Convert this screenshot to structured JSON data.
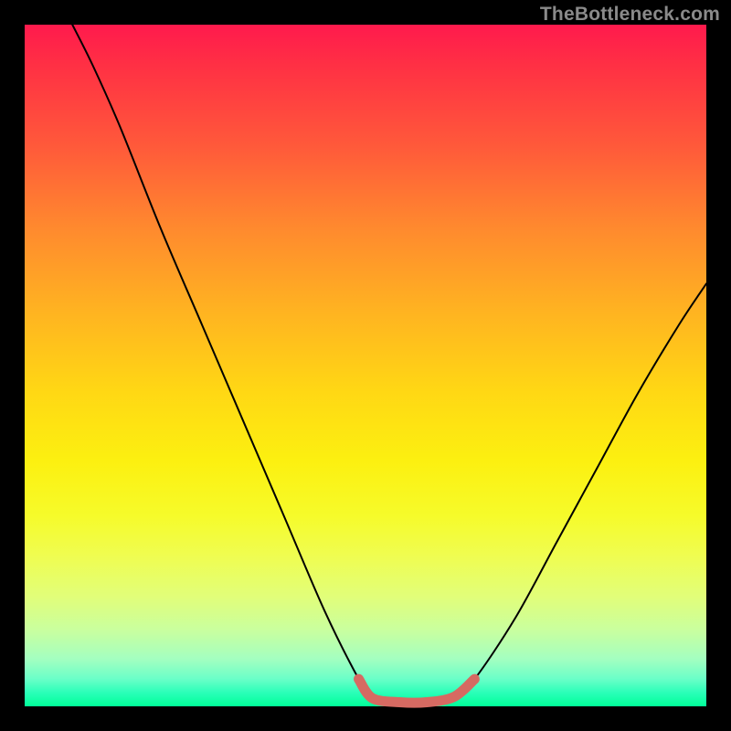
{
  "watermark": "TheBottleneck.com",
  "chart_data": {
    "type": "line",
    "title": "",
    "xlabel": "",
    "ylabel": "",
    "xlim": [
      0,
      100
    ],
    "ylim": [
      0,
      100
    ],
    "grid": false,
    "legend": "none",
    "series": [
      {
        "name": "bottleneck-curve",
        "points": [
          {
            "x": 7,
            "y": 100
          },
          {
            "x": 10,
            "y": 94
          },
          {
            "x": 14,
            "y": 85
          },
          {
            "x": 20,
            "y": 70
          },
          {
            "x": 26,
            "y": 56
          },
          {
            "x": 32,
            "y": 42
          },
          {
            "x": 38,
            "y": 28
          },
          {
            "x": 44,
            "y": 14
          },
          {
            "x": 49,
            "y": 4
          },
          {
            "x": 51,
            "y": 1.2
          },
          {
            "x": 55,
            "y": 0.6
          },
          {
            "x": 59,
            "y": 0.6
          },
          {
            "x": 63,
            "y": 1.4
          },
          {
            "x": 66,
            "y": 4
          },
          {
            "x": 72,
            "y": 13
          },
          {
            "x": 78,
            "y": 24
          },
          {
            "x": 84,
            "y": 35
          },
          {
            "x": 90,
            "y": 46
          },
          {
            "x": 96,
            "y": 56
          },
          {
            "x": 100,
            "y": 62
          }
        ]
      },
      {
        "name": "optimal-range",
        "points": [
          {
            "x": 49,
            "y": 4
          },
          {
            "x": 51,
            "y": 1.2
          },
          {
            "x": 55,
            "y": 0.6
          },
          {
            "x": 59,
            "y": 0.6
          },
          {
            "x": 63,
            "y": 1.4
          },
          {
            "x": 66,
            "y": 4
          }
        ]
      }
    ],
    "colors": {
      "gradient_top": "#ff1a4d",
      "gradient_bottom": "#00ff99",
      "curve": "#000000",
      "optimal_stroke": "#d66a62",
      "frame": "#000000"
    }
  }
}
